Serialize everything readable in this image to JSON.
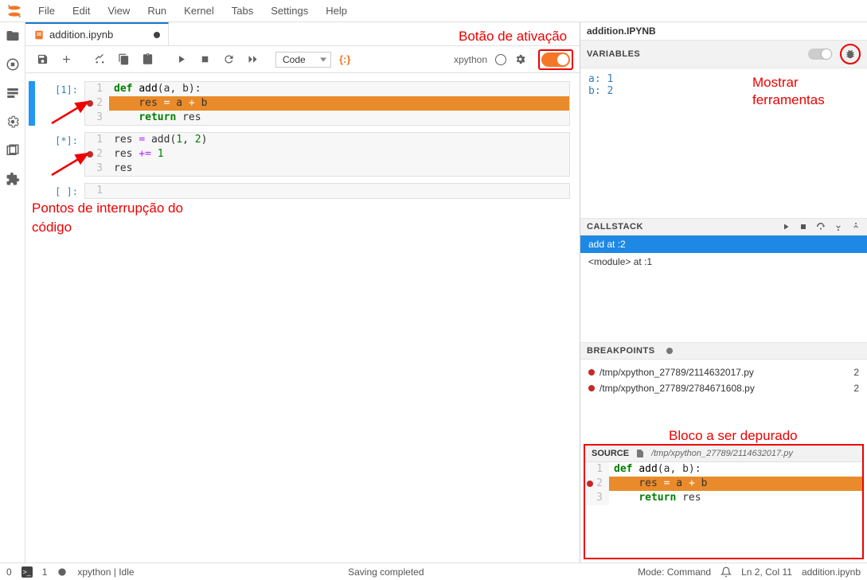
{
  "menu": {
    "items": [
      "File",
      "Edit",
      "View",
      "Run",
      "Kernel",
      "Tabs",
      "Settings",
      "Help"
    ]
  },
  "tab": {
    "title": "addition.ipynb"
  },
  "toolbar": {
    "celltype": "Code",
    "kernel": "xpython"
  },
  "cells": [
    {
      "prompt": "[1]:",
      "active": true,
      "lines": [
        {
          "n": 1,
          "bp": false,
          "hl": false,
          "html": "<span class='kw'>def</span> <span class='nm'>add</span>(a, b):"
        },
        {
          "n": 2,
          "bp": true,
          "hl": true,
          "html": "    res <span class='op'>=</span> a <span class='op'>+</span> b"
        },
        {
          "n": 3,
          "bp": false,
          "hl": false,
          "html": "    <span class='kw'>return</span> res"
        }
      ]
    },
    {
      "prompt": "[*]:",
      "active": false,
      "lines": [
        {
          "n": 1,
          "bp": false,
          "hl": false,
          "html": "res <span class='op'>=</span> add(<span class='num'>1</span>, <span class='num'>2</span>)"
        },
        {
          "n": 2,
          "bp": true,
          "hl": false,
          "html": "res <span class='op'>+=</span> <span class='num'>1</span>"
        },
        {
          "n": 3,
          "bp": false,
          "hl": false,
          "html": "res"
        }
      ]
    },
    {
      "prompt": "[ ]:",
      "active": false,
      "lines": [
        {
          "n": 1,
          "bp": false,
          "hl": false,
          "html": ""
        }
      ]
    }
  ],
  "debugger": {
    "title": "addition.IPYNB",
    "variables_label": "VARIABLES",
    "variables": [
      {
        "name": "a",
        "value": "1"
      },
      {
        "name": "b",
        "value": "2"
      }
    ],
    "callstack_label": "CALLSTACK",
    "callstack": [
      {
        "text": "add at :2",
        "selected": true
      },
      {
        "text": "<module> at :1",
        "selected": false
      }
    ],
    "breakpoints_label": "BREAKPOINTS",
    "breakpoints": [
      {
        "path": "/tmp/xpython_27789/2114632017.py",
        "line": "2"
      },
      {
        "path": "/tmp/xpython_27789/2784671608.py",
        "line": "2"
      }
    ],
    "source_label": "SOURCE",
    "source_path": "/tmp/xpython_27789/2114632017.py",
    "source_lines": [
      {
        "n": 1,
        "bp": false,
        "hl": false,
        "html": "<span class='kw'>def</span> <span class='nm'>add</span>(a, b):"
      },
      {
        "n": 2,
        "bp": true,
        "hl": true,
        "html": "    res <span class='op'>=</span> a <span class='op'>+</span> b"
      },
      {
        "n": 3,
        "bp": false,
        "hl": false,
        "html": "    <span class='kw'>return</span> res"
      }
    ]
  },
  "statusbar": {
    "left1": "0",
    "left2": "1",
    "kernel": "xpython | Idle",
    "center": "Saving completed",
    "mode": "Mode: Command",
    "pos": "Ln 2, Col 11",
    "file": "addition.ipynb"
  },
  "annotations": {
    "toggle": "Botão de ativação",
    "tools": "Mostrar ferramentas",
    "breakpoints": "Pontos de interrupção do código",
    "source": "Bloco a ser depurado"
  }
}
